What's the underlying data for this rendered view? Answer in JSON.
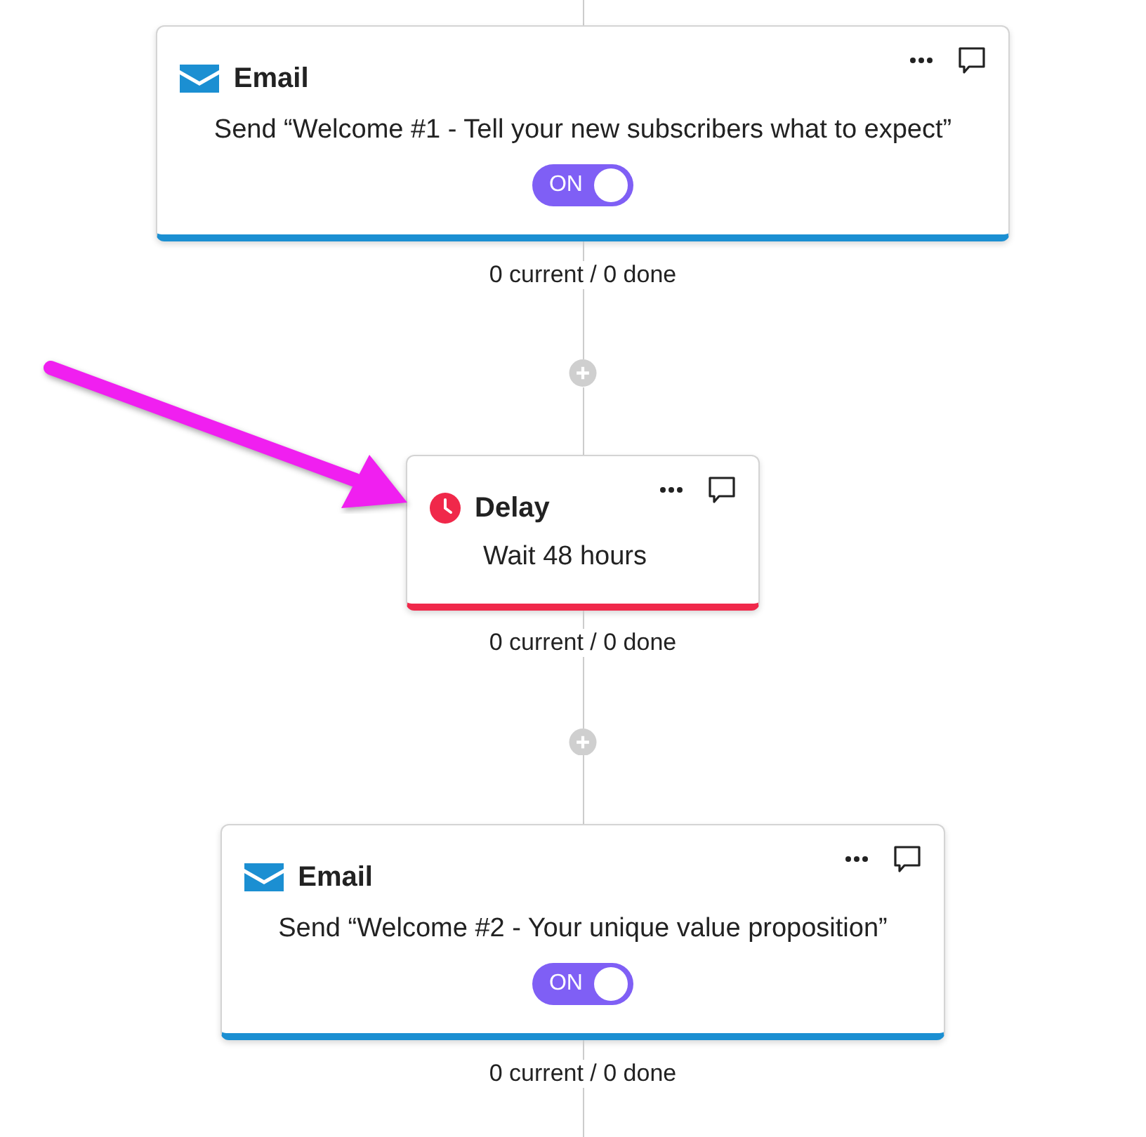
{
  "nodes": [
    {
      "kind": "email",
      "title": "Email",
      "description": "Send “Welcome #1 - Tell your new subscribers what to expect”",
      "toggle": {
        "on": true,
        "label": "ON"
      },
      "stats": "0 current / 0 done"
    },
    {
      "kind": "delay",
      "title": "Delay",
      "description": "Wait 48 hours",
      "stats": "0 current / 0 done"
    },
    {
      "kind": "email",
      "title": "Email",
      "description": "Send “Welcome #2 - Your unique value proposition”",
      "toggle": {
        "on": true,
        "label": "ON"
      },
      "stats": "0 current / 0 done"
    }
  ]
}
